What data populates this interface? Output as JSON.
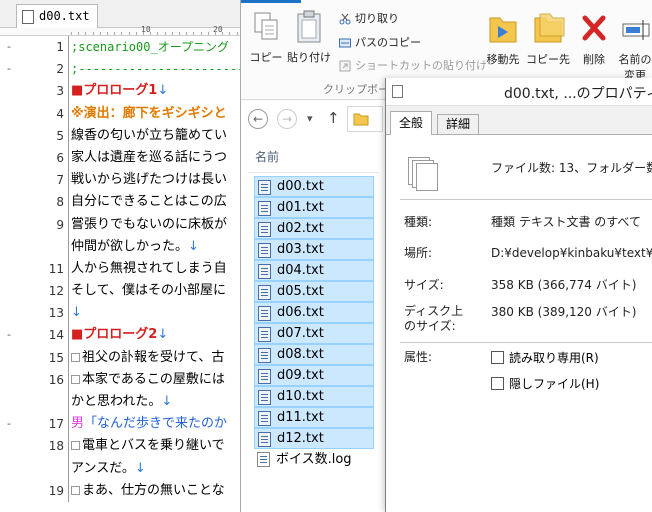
{
  "editor": {
    "tab_label": "d00.txt",
    "ruler_marks": [
      "10",
      "20"
    ],
    "lines": [
      {
        "fold": "-",
        "num": "1",
        "style": "comment",
        "text": ";scenario00_オープニング",
        "arrow": ""
      },
      {
        "fold": "-",
        "num": "2",
        "style": "comment",
        "text": ";---------------------------",
        "arrow": ""
      },
      {
        "fold": "",
        "num": "3",
        "style": "red",
        "text": "■プロローグ1",
        "arrow": "↓"
      },
      {
        "fold": "",
        "num": "4",
        "style": "orange",
        "text": "※演出：廊下をギシギシと",
        "arrow": ""
      },
      {
        "fold": "",
        "num": "5",
        "style": "normal",
        "text": "線香の匂いが立ち籠めてい",
        "arrow": ""
      },
      {
        "fold": "",
        "num": "6",
        "style": "normal",
        "text": "家人は遺産を巡る話にうつ",
        "arrow": ""
      },
      {
        "fold": "",
        "num": "7",
        "style": "normal",
        "text": "戦いから逃げたつけは長い",
        "arrow": ""
      },
      {
        "fold": "",
        "num": "8",
        "style": "normal",
        "text": "自分にできることはこの広",
        "arrow": ""
      },
      {
        "fold": "",
        "num": "9",
        "style": "normal",
        "text": "嘗張りでもないのに床板が",
        "arrow": ""
      },
      {
        "fold": "",
        "num": "",
        "style": "normal",
        "text": "仲間が欲しかった。",
        "arrow": "↓"
      },
      {
        "fold": "",
        "num": "11",
        "style": "normal",
        "text": "人から無視されてしまう自",
        "arrow": ""
      },
      {
        "fold": "",
        "num": "12",
        "style": "normal",
        "text": "そして、僕はその小部屋に",
        "arrow": ""
      },
      {
        "fold": "",
        "num": "13",
        "style": "normal",
        "text": "",
        "arrow": "↓"
      },
      {
        "fold": "-",
        "num": "14",
        "style": "red",
        "text": "■プロローグ2",
        "arrow": "↓"
      },
      {
        "fold": "",
        "num": "15",
        "style": "sq",
        "text": "祖父の訃報を受けて、古",
        "arrow": ""
      },
      {
        "fold": "",
        "num": "16",
        "style": "sq",
        "text": "本家であるこの屋敷には",
        "arrow": ""
      },
      {
        "fold": "",
        "num": "",
        "style": "normal",
        "text": "かと思われた。",
        "arrow": "↓"
      },
      {
        "fold": "-",
        "num": "17",
        "style": "male",
        "text": "「なんだ歩きで来たのか",
        "arrow": "",
        "prefix": "男"
      },
      {
        "fold": "",
        "num": "18",
        "style": "sq",
        "text": "電車とバスを乗り継いで",
        "arrow": ""
      },
      {
        "fold": "",
        "num": "",
        "style": "normal",
        "text": "アンスだ。",
        "arrow": "↓"
      },
      {
        "fold": "",
        "num": "19",
        "style": "sq",
        "text": "まあ、仕方の無いことな",
        "arrow": ""
      }
    ]
  },
  "ribbon": {
    "copy": "コピー",
    "paste": "貼り付け",
    "cut": "切り取り",
    "copy_path": "パスのコピー",
    "paste_shortcut": "ショートカットの貼り付け",
    "group_label": "クリップボー",
    "move_to": "移動先",
    "copy_to": "コピー先",
    "delete": "削除",
    "rename_line1": "名前の",
    "rename_line2": "変更"
  },
  "nav": {
    "back": "←",
    "forward": "→",
    "dropdown": "▾",
    "up": "↑"
  },
  "filelist": {
    "header": "名前",
    "files": [
      "d00.txt",
      "d01.txt",
      "d02.txt",
      "d03.txt",
      "d04.txt",
      "d05.txt",
      "d06.txt",
      "d07.txt",
      "d08.txt",
      "d09.txt",
      "d10.txt",
      "d11.txt",
      "d12.txt",
      "ボイス数.log"
    ]
  },
  "props": {
    "title": "d00.txt, ...のプロパティ",
    "tabs": [
      "全般",
      "詳細"
    ],
    "summary": "ファイル数: 13、フォルダー数: 0",
    "type_label": "種類:",
    "type_value": "種類 テキスト文書 のすべて",
    "location_label": "場所:",
    "location_value": "D:¥develop¥kinbaku¥text¥s",
    "size_label": "サイズ:",
    "size_value": "358 KB (366,774 バイト)",
    "disk_label_1": "ディスク上",
    "disk_label_2": "のサイズ:",
    "disk_value": "380 KB (389,120 バイト)",
    "attr_label": "属性:",
    "readonly": "読み取り専用(R)",
    "hidden": "隠しファイル(H)"
  },
  "colors": {
    "comment": "#1a9a1a",
    "heading": "#d62020",
    "direction": "#e07b00",
    "dialogue": "#1f5fd8",
    "selection": "#cce8ff"
  }
}
